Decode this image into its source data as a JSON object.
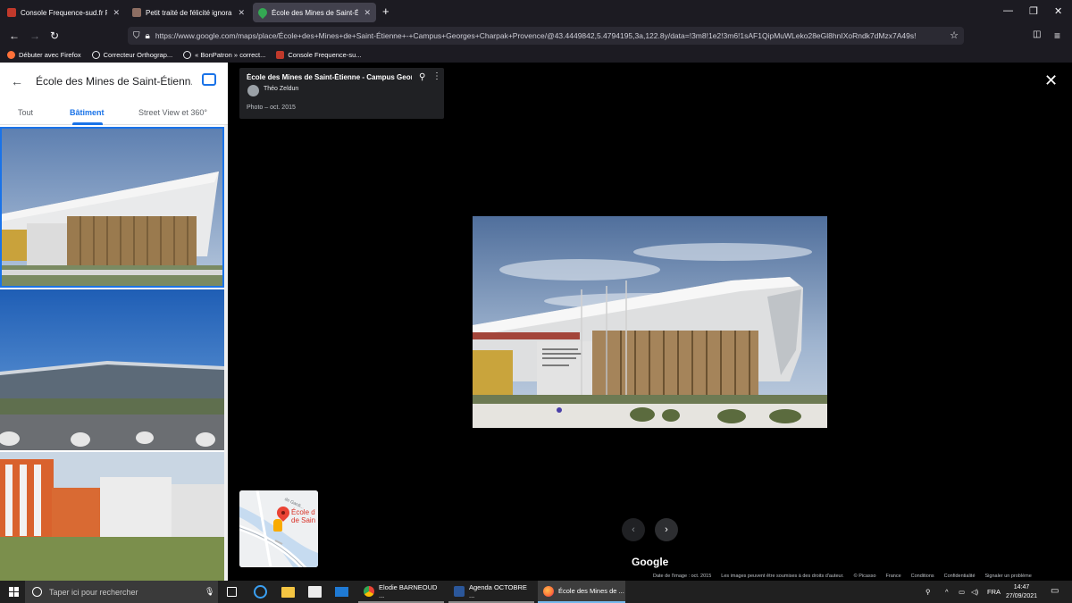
{
  "browser": {
    "tabs": [
      {
        "label": "Console Frequence-sud.fr Pro",
        "close": "✕",
        "favicon_color": "#c0392b"
      },
      {
        "label": "Petit traité de félicité ignorante",
        "close": "✕",
        "favicon_color": "#8d6e63"
      },
      {
        "label": "École des Mines de Saint-Étienne",
        "close": "✕",
        "favicon_color": "#34a853"
      }
    ],
    "new_tab": "+",
    "window_controls": {
      "minimize": "—",
      "restore": "❐",
      "close": "✕"
    },
    "url": "https://www.google.com/maps/place/École+des+Mines+de+Saint-Étienne+-+Campus+Georges+Charpak+Provence/@43.4449842,5.4794195,3a,122.8y/data=!3m8!1e2!3m6!1sAF1QipMuWLeko28eGl8hnIXoRndk7dMzx7A49s!",
    "bookmarks": [
      {
        "label": "Débuter avec Firefox",
        "color": "#ff7139"
      },
      {
        "label": "Correcteur Orthograp...",
        "color": "#e8eaed"
      },
      {
        "label": "« BonPatron » correct...",
        "color": "#e8eaed"
      },
      {
        "label": "Console Frequence-su...",
        "color": "#c0392b"
      }
    ]
  },
  "sidebar": {
    "title": "École des Mines de Saint-Étienn...",
    "tabs": [
      "Tout",
      "Bâtiment",
      "Street View et 360°"
    ],
    "active_tab": "Bâtiment"
  },
  "photo_info": {
    "title": "École des Mines de Saint-Étienne - Campus Georg...",
    "author": "Théo Zeldun",
    "date": "Photo – oct. 2015"
  },
  "map": {
    "place_label_line1": "École d",
    "place_label_line2": "de Sain",
    "road_label": "de Gardi..."
  },
  "viewer": {
    "brand": "Google",
    "footer": [
      "Date de l'image : oct. 2015",
      "Les images peuvent être soumises à des droits d'auteur.",
      "© Picasso",
      "France",
      "Conditions",
      "Confidentialité",
      "Signaler un problème"
    ]
  },
  "taskbar": {
    "search_placeholder": "Taper ici pour rechercher",
    "apps": [
      {
        "label": "Elodie BARNEOUD ...",
        "color": "#34a853"
      },
      {
        "label": "Agenda OCTOBRE ...",
        "color": "#2b579a"
      },
      {
        "label": "École des Mines de ...",
        "color": "#ff7139"
      }
    ],
    "language": "FRA",
    "time": "14:47",
    "date": "27/09/2021"
  },
  "colors": {
    "accent": "#1a73e8",
    "viewer_bg": "#000000",
    "chrome_bg": "#1c1b22"
  }
}
